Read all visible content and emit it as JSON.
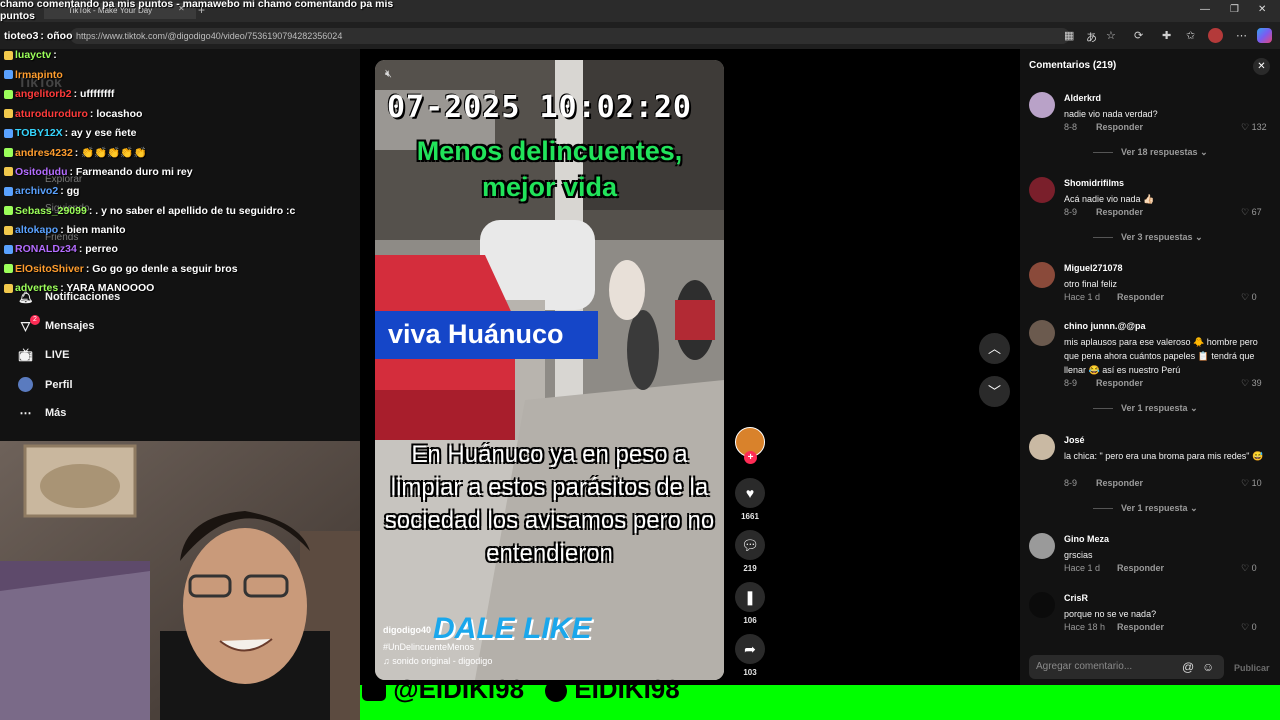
{
  "colors": {
    "green_screen": "#00ff00",
    "tiktok_red": "#fe2c55",
    "chat_bg": "#121212"
  },
  "browser": {
    "tab_title": "TikTok - Make Your Day",
    "url": "https://www.tiktok.com/@digodigo40/video/7536190794282356024"
  },
  "chat": {
    "top_line": "chamo comentando pa mis puntos - mamawebo mi chamo comentando pa mis puntos",
    "messages": [
      {
        "user": "tioteo3",
        "text": ": oñoo",
        "color": "#ffffff"
      },
      {
        "user": "luayctv",
        "text": ":",
        "color": "#9cff5a"
      },
      {
        "user": "lrmapinto",
        "text": "",
        "color": "#ff9d2e"
      },
      {
        "user": "angelitorb2",
        "text": ": uffffffff",
        "color": "#ff3b3b"
      },
      {
        "user": "aturoduroduro",
        "text": ": locashoo",
        "color": "#ff3b3b"
      },
      {
        "user": "TOBY12X",
        "text": ": ay y ese ñete",
        "color": "#36d6ff"
      },
      {
        "user": "andres4232",
        "text": ": 👏👏👏👏👏",
        "color": "#ff9d2e"
      },
      {
        "user": "Ositodudu",
        "text": ": Farmeando duro mi rey",
        "color": "#b46cff"
      },
      {
        "user": "archivo2",
        "text": ": gg",
        "color": "#5aa2ff"
      },
      {
        "user": "Sebass_29099",
        "text": ": . y no saber el apellido de tu seguidro :c",
        "color": "#9cff5a"
      },
      {
        "user": "altokapo",
        "text": ": bien manito",
        "color": "#5aa2ff"
      },
      {
        "user": "RONALDz34",
        "text": ": perreo",
        "color": "#b46cff"
      },
      {
        "user": "ElOsitoShiver",
        "text": ": Go go go denle a seguir bros",
        "color": "#ff9d2e"
      },
      {
        "user": "advertes",
        "text": ": YARA MANOOOO",
        "color": "#9cff5a"
      }
    ]
  },
  "sidebar": {
    "logo": "TikTok",
    "ghost_items": [
      "Explorar",
      "Siguiendo",
      "Friends"
    ],
    "items": [
      {
        "label": "Notificaciones",
        "icon": "bell-icon"
      },
      {
        "label": "Mensajes",
        "icon": "send-icon",
        "badge": "2"
      },
      {
        "label": "LIVE",
        "icon": "live-icon"
      },
      {
        "label": "Perfil",
        "icon": "profile-icon"
      },
      {
        "label": "Más",
        "icon": "more-icon"
      }
    ]
  },
  "video": {
    "timestamp": "07-2025 10:02:20",
    "caption_line1": "Menos delincuentes,",
    "caption_line2": "mejor vida",
    "banner": "viva Huánuco",
    "overlay_text": "En Huánuco ya en peso a limpiar a estos parásitos de la  sociedad   los avisamos pero no entendieron",
    "cta": "DALE LIKE",
    "author": "digodigo40",
    "hashtag": "#UnDelincuenteMenos",
    "sound": "♫ sonido original - digodigo"
  },
  "actions": {
    "likes": "1661",
    "comments": "219",
    "saves": "106",
    "shares": "103"
  },
  "comments_panel": {
    "title": "Comentarios (219)",
    "input_placeholder": "Agregar comentario...",
    "post_label": "Publicar",
    "reply_label": "Responder",
    "items": [
      {
        "user": "Alderkrd",
        "text": "nadie vio nada verdad?",
        "date": "8-8",
        "likes": "132",
        "replies": "Ver 18 respuestas",
        "avatar": "#b9a2c8"
      },
      {
        "user": "Shomidrifilms",
        "text": "Acá nadie vio nada 👍🏻",
        "date": "8-9",
        "likes": "67",
        "replies": "Ver 3 respuestas",
        "avatar": "#7a1f2b"
      },
      {
        "user": "Miguel271078",
        "text": "otro final feliz",
        "date": "Hace 1 d",
        "likes": "0",
        "replies": "",
        "avatar": "#8a4a3a"
      },
      {
        "user": "chino junnn.@@pa",
        "text": "mis aplausos para ese valeroso 🐥 hombre pero que pena ahora cuántos papeles 📋 tendrá que llenar 😂 así es nuestro Perú",
        "date": "8-9",
        "likes": "39",
        "replies": "Ver 1 respuesta",
        "avatar": "#6b5a4e"
      },
      {
        "user": "José",
        "text": "la chica: \" pero era una broma para mis redes\" 😅",
        "date": "8-9",
        "likes": "10",
        "replies": "Ver 1 respuesta",
        "avatar": "#c9b9a3"
      },
      {
        "user": "Gino Meza",
        "text": "grscias",
        "date": "Hace 1 d",
        "likes": "0",
        "replies": "",
        "avatar": "#9a9a9a"
      },
      {
        "user": "CrisR",
        "text": "porque no se ve nada?",
        "date": "Hace 18 h",
        "likes": "0",
        "replies": "",
        "avatar": "#0b0b0b"
      }
    ]
  },
  "stream_bar": {
    "handle1": "@EIDIKI98",
    "handle2": "EIDIKI98"
  }
}
